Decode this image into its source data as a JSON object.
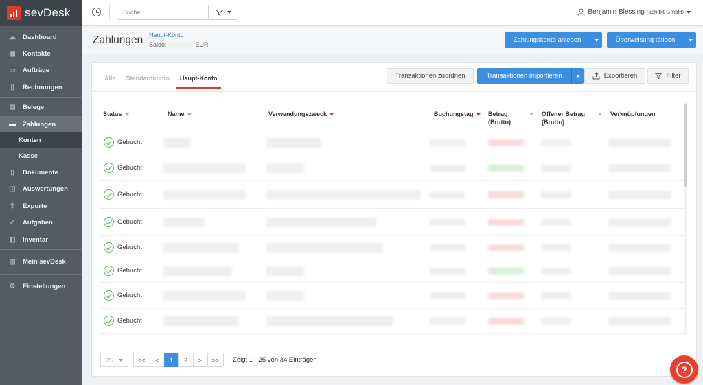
{
  "brand": {
    "name": "sevDesk"
  },
  "sidebar": {
    "items": [
      {
        "label": "Dashboard",
        "icon": "cloud-icon"
      },
      {
        "label": "Kontakte",
        "icon": "contacts-icon"
      },
      {
        "label": "Aufträge",
        "icon": "folder-icon"
      },
      {
        "label": "Rechnungen",
        "icon": "document-icon"
      },
      {
        "label": "Belege",
        "icon": "receipt-icon"
      },
      {
        "label": "Zahlungen",
        "icon": "wallet-icon"
      },
      {
        "label": "Konten"
      },
      {
        "label": "Kasse"
      },
      {
        "label": "Dokumente",
        "icon": "file-icon"
      },
      {
        "label": "Auswertungen",
        "icon": "chart-icon"
      },
      {
        "label": "Exporte",
        "icon": "export-icon"
      },
      {
        "label": "Aufgaben",
        "icon": "check-icon"
      },
      {
        "label": "Inventar",
        "icon": "box-icon"
      },
      {
        "label": "Mein sevDesk",
        "icon": "bar-chart-icon"
      },
      {
        "label": "Einstellungen",
        "icon": "gear-icon"
      }
    ]
  },
  "topbar": {
    "search_placeholder": "Suche",
    "user_name": "Benjamin Blessing",
    "user_company": "(achtbit GmbH)"
  },
  "header": {
    "title": "Zahlungen",
    "account_link": "Haupt-Konto",
    "saldo_label": "Saldo:",
    "currency": "EUR",
    "btn_create_account": "Zahlungskonto anlegen",
    "btn_transfer": "Überweisung tätigen"
  },
  "tabs": [
    "Alle",
    "Standardkonto",
    "Haupt-Konto"
  ],
  "actions": {
    "assign": "Transaktionen zuordnen",
    "import": "Transaktionen importieren",
    "export": "Exportieren",
    "filter": "Filter"
  },
  "table": {
    "columns": {
      "status": "Status",
      "name": "Name",
      "purpose": "Verwendungszweck",
      "booking_day": "Buchungstag",
      "amount_1": "Betrag",
      "amount_2": "(Brutto)",
      "open_1": "Offener Betrag",
      "open_2": "(Brutto)",
      "links": "Verknüpfungen"
    },
    "rows": [
      {
        "status": "Gebucht",
        "sign": "red"
      },
      {
        "status": "Gebucht",
        "sign": "green"
      },
      {
        "status": "Gebucht",
        "sign": "red"
      },
      {
        "status": "Gebucht",
        "sign": "red"
      },
      {
        "status": "Gebucht",
        "sign": "red"
      },
      {
        "status": "Gebucht",
        "sign": "green"
      },
      {
        "status": "Gebucht",
        "sign": "red"
      },
      {
        "status": "Gebucht",
        "sign": "red"
      }
    ]
  },
  "pagination": {
    "page_size": "25",
    "first": "<<",
    "prev": "<",
    "pages": [
      "1",
      "2"
    ],
    "next": ">",
    "last": ">>",
    "info": "Zeigt 1 - 25 von 34 Einträgen"
  },
  "help": {
    "label": "?"
  }
}
